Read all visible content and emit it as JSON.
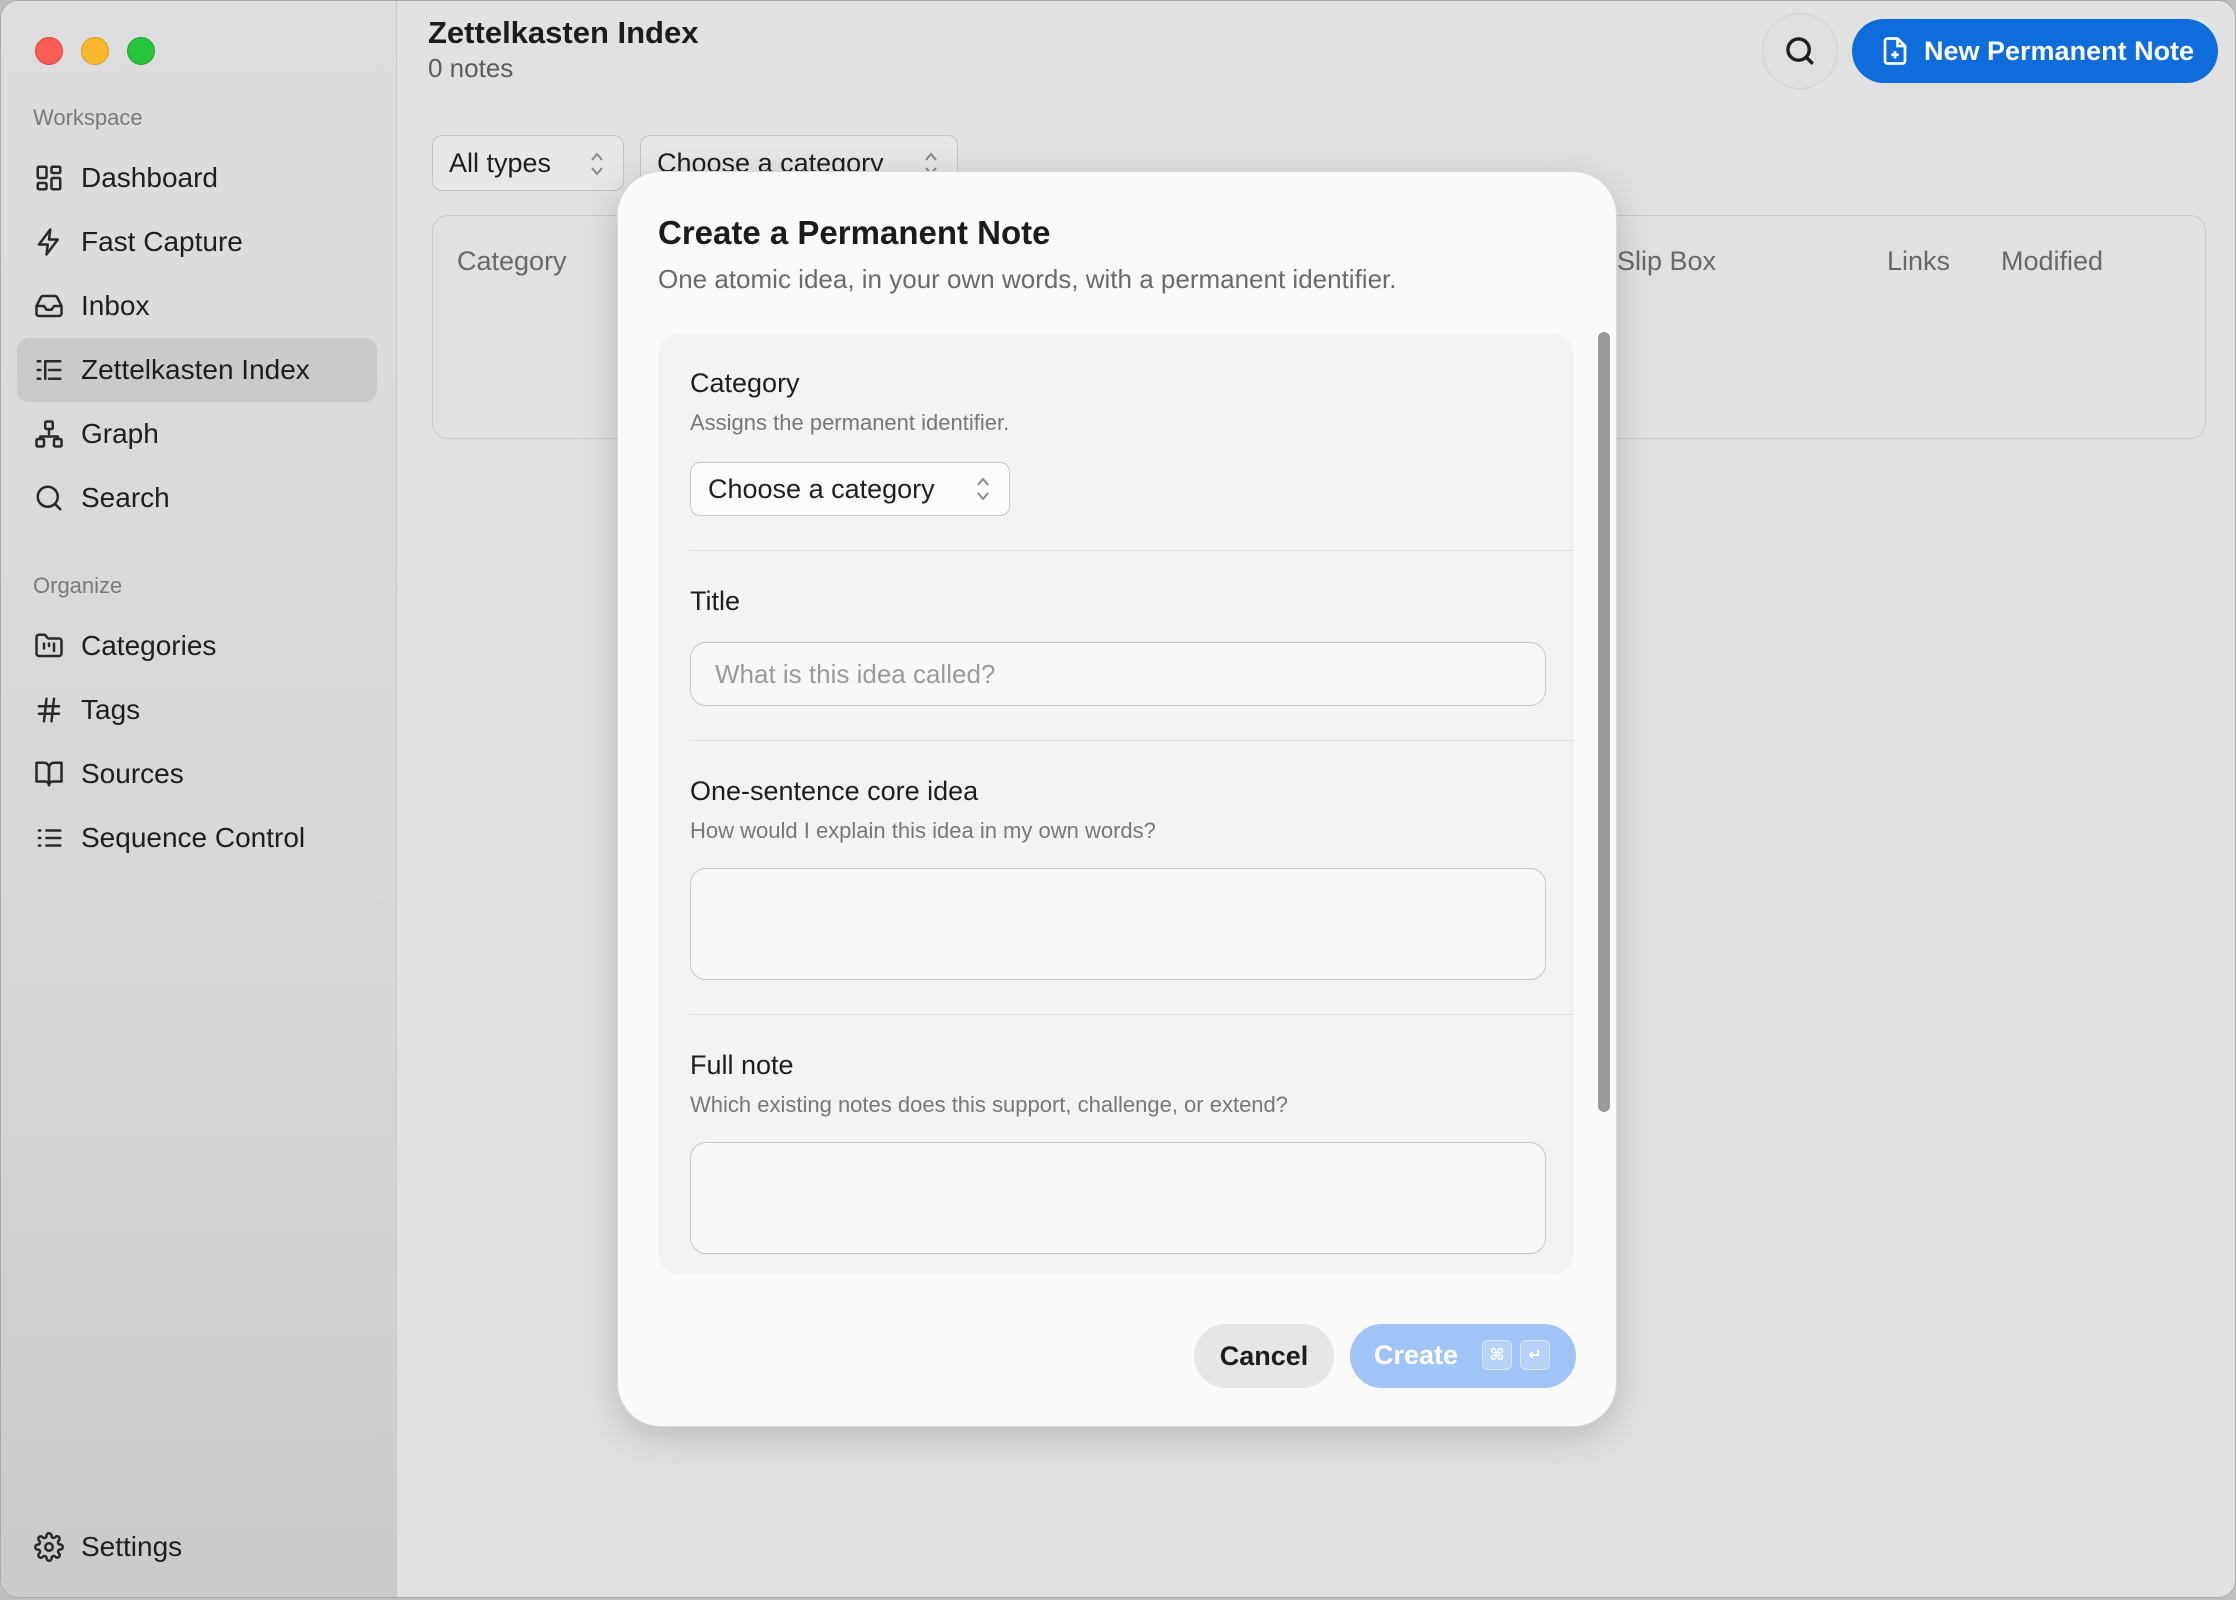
{
  "sidebar": {
    "workspace_label": "Workspace",
    "organize_label": "Organize",
    "workspace_items": [
      {
        "label": "Dashboard",
        "icon": "dashboard-icon"
      },
      {
        "label": "Fast Capture",
        "icon": "lightning-icon"
      },
      {
        "label": "Inbox",
        "icon": "inbox-icon"
      },
      {
        "label": "Zettelkasten Index",
        "icon": "index-list-icon",
        "active": true
      },
      {
        "label": "Graph",
        "icon": "graph-icon"
      },
      {
        "label": "Search",
        "icon": "search-icon"
      }
    ],
    "organize_items": [
      {
        "label": "Categories",
        "icon": "categories-icon"
      },
      {
        "label": "Tags",
        "icon": "hash-icon"
      },
      {
        "label": "Sources",
        "icon": "book-icon"
      },
      {
        "label": "Sequence Control",
        "icon": "numbered-list-icon"
      }
    ],
    "settings_label": "Settings"
  },
  "header": {
    "title": "Zettelkasten Index",
    "count": "0 notes",
    "new_note_label": "New Permanent Note"
  },
  "filters": {
    "type": "All types",
    "category": "Choose a category"
  },
  "table": {
    "columns": [
      "Category",
      "Slip Box",
      "Links",
      "Modified"
    ]
  },
  "modal": {
    "title": "Create a Permanent Note",
    "subtitle": "One atomic idea, in your own words, with a permanent identifier.",
    "category": {
      "label": "Category",
      "help": "Assigns the permanent identifier.",
      "value": "Choose a category"
    },
    "title_field": {
      "label": "Title",
      "placeholder": "What is this idea called?"
    },
    "core_idea": {
      "label": "One-sentence core idea",
      "help": "How would I explain this idea in my own words?"
    },
    "full_note": {
      "label": "Full note",
      "help": "Which existing notes does this support, challenge, or extend?"
    },
    "cancel_label": "Cancel",
    "create_label": "Create",
    "shortcut_keys": [
      "⌘",
      "↵"
    ]
  },
  "colors": {
    "accent": "#0f6fe0",
    "accent_disabled": "#a0c4f6"
  }
}
